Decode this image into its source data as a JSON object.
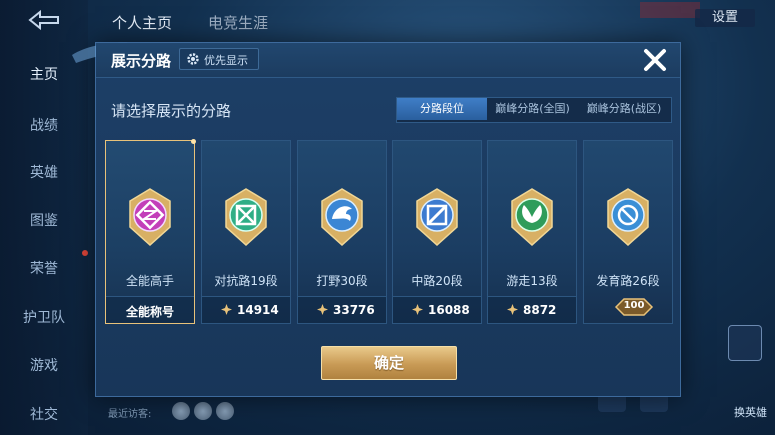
{
  "background": {
    "nav_items": [
      "主页",
      "战绩",
      "英雄",
      "图鉴",
      "荣誉",
      "护卫队",
      "游戏",
      "社交"
    ],
    "top_tabs": [
      "个人主页",
      "电竞生涯"
    ],
    "settings_label": "设置",
    "recent_visitors_label": "最近访客:",
    "right_label": "换英雄"
  },
  "modal": {
    "title": "展示分路",
    "priority_label": "优先显示",
    "subtitle": "请选择展示的分路",
    "segments": [
      "分路段位",
      "巅峰分路(全国)",
      "巅峰分路(战区)"
    ],
    "active_segment": "分路段位",
    "confirm_label": "确定"
  },
  "lanes": [
    {
      "title": "全能高手",
      "footer": "全能称号",
      "selected": true,
      "badge_color": "#c33fb9",
      "icon": "allround-icon"
    },
    {
      "title": "对抗路19段",
      "value": "14914",
      "badge_color": "#2fae86",
      "icon": "clash-lane-icon"
    },
    {
      "title": "打野30段",
      "value": "33776",
      "badge_color": "#3b86d4",
      "icon": "jungle-dragon-icon"
    },
    {
      "title": "中路20段",
      "value": "16088",
      "badge_color": "#3c7bd0",
      "icon": "mid-lane-icon"
    },
    {
      "title": "游走13段",
      "value": "8872",
      "badge_color": "#2f9c5a",
      "icon": "roam-leaf-icon"
    },
    {
      "title": "发育路26段",
      "rank": "100",
      "badge_color": "#3a8fd6",
      "icon": "farm-lane-icon"
    }
  ],
  "colors": {
    "accent_gold": "#e8c27a",
    "active_tab": "#3f7ec7"
  }
}
